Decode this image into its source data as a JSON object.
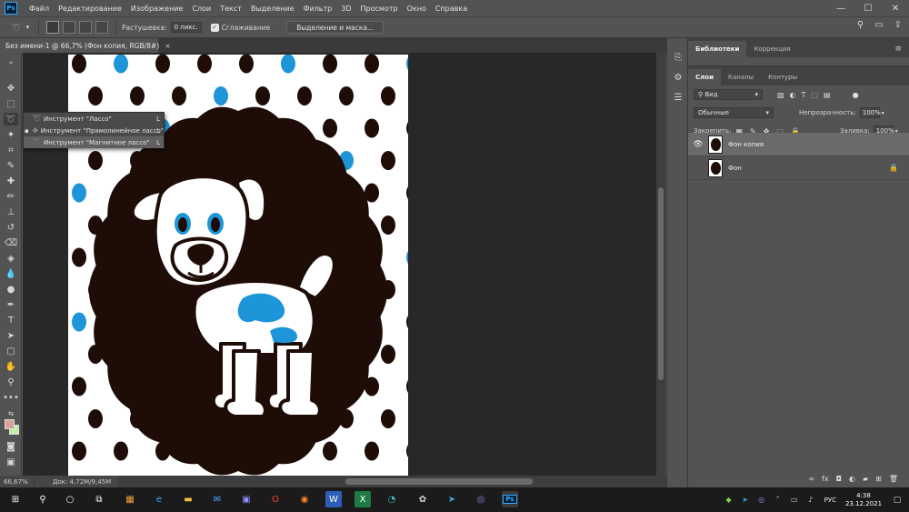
{
  "app": {
    "logo": "Ps"
  },
  "menu": [
    "Файл",
    "Редактирование",
    "Изображение",
    "Слои",
    "Текст",
    "Выделение",
    "Фильтр",
    "3D",
    "Просмотр",
    "Окно",
    "Справка"
  ],
  "window_controls": {
    "minimize": "—",
    "maximize": "☐",
    "close": "✕"
  },
  "options": {
    "feather_label": "Растушевка:",
    "feather_value": "0 пикс.",
    "antialias_label": "Сглаживание",
    "select_mask_button": "Выделение и маска..."
  },
  "document": {
    "tab_title": "Без имени-1 @ 66,7% (Фон копия, RGB/8#)",
    "tab_close": "×",
    "zoom": "66,67%",
    "doc_info": "Док: 4,72M/9,45M"
  },
  "flyout": {
    "items": [
      {
        "label": "Инструмент \"Лассо\"",
        "key": "L",
        "icon": "lasso-icon"
      },
      {
        "label": "Инструмент \"Прямолинейное лассо\"",
        "key": "L",
        "icon": "polygonal-lasso-icon"
      },
      {
        "label": "Инструмент \"Магнитное лассо\"",
        "key": "L",
        "icon": "magnetic-lasso-icon"
      }
    ]
  },
  "panels": {
    "top_tabs": [
      "Библиотеки",
      "Коррекция"
    ],
    "layer_tabs": [
      "Слои",
      "Каналы",
      "Контуры"
    ],
    "filter_kind": "Вид",
    "blend_mode": "Обычные",
    "opacity_label": "Непрозрачность:",
    "opacity_value": "100%",
    "lock_label": "Закрепить:",
    "fill_label": "Заливка:",
    "fill_value": "100%"
  },
  "layers": [
    {
      "name": "Фон копия",
      "selected": true,
      "locked": false
    },
    {
      "name": "Фон",
      "selected": false,
      "locked": true
    }
  ],
  "taskbar": {
    "language": "РУС",
    "time": "4:38",
    "date": "23.12.2021"
  },
  "colors": {
    "foreground": "#d9a19a",
    "background": "#bff0a4",
    "dot_dark": "#1e0c07",
    "dot_blue": "#1d95d8",
    "ps_blue": "#31a8ff"
  }
}
